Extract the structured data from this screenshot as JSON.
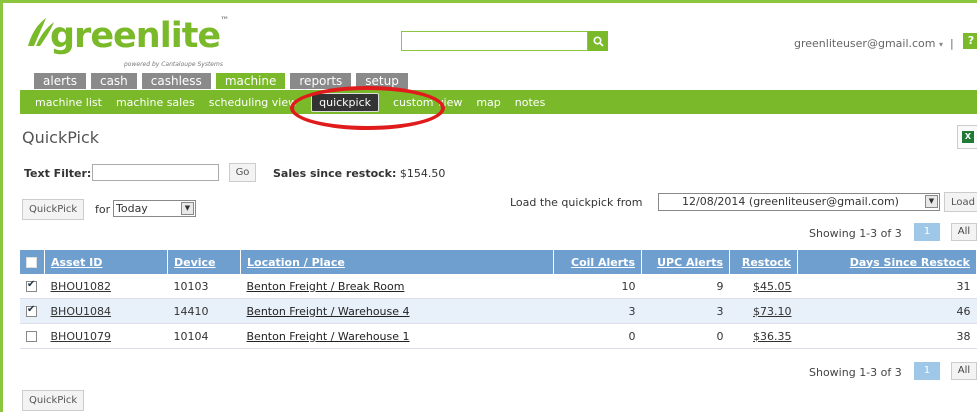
{
  "brand": {
    "logo_main": "greenlite",
    "logo_tm": "™",
    "logo_sub": "powered by Cantaloupe Systems"
  },
  "header": {
    "user_email": "greenliteuser@gmail.com",
    "user_caret": "▾",
    "separator": "|",
    "help_label": "?"
  },
  "tabs": [
    "alerts",
    "cash",
    "cashless",
    "machine",
    "reports",
    "setup"
  ],
  "active_tab": "machine",
  "subnav": [
    "machine list",
    "machine sales",
    "scheduling view",
    "quickpick",
    "custom view",
    "map",
    "notes"
  ],
  "active_subnav": "quickpick",
  "page": {
    "title": "QuickPick"
  },
  "filter": {
    "label": "Text Filter:",
    "value": "",
    "go_label": "Go",
    "sales_label": "Sales since restock:",
    "sales_value": "$154.50"
  },
  "controls": {
    "quickpick_label": "QuickPick",
    "for_label": "for",
    "for_value": "Today",
    "load_label": "Load the quickpick from",
    "load_value": "12/08/2014 (greenliteuser@gmail.com)",
    "load_button": "Load"
  },
  "pagination": {
    "showing": "Showing 1-3 of 3",
    "page": "1",
    "all_label": "All"
  },
  "table": {
    "headers": [
      "Asset ID",
      "Device",
      "Location / Place",
      "Coil Alerts",
      "UPC Alerts",
      "Restock",
      "Days Since Restock"
    ],
    "rows": [
      {
        "checked": true,
        "asset": "BHOU1082",
        "device": "10103",
        "location": "Benton Freight / Break Room",
        "coil": "10",
        "upc": "9",
        "restock": "$45.05",
        "days": "31"
      },
      {
        "checked": true,
        "asset": "BHOU1084",
        "device": "14410",
        "location": "Benton Freight / Warehouse 4",
        "coil": "3",
        "upc": "3",
        "restock": "$73.10",
        "days": "46"
      },
      {
        "checked": false,
        "asset": "BHOU1079",
        "device": "10104",
        "location": "Benton Freight / Warehouse 1",
        "coil": "0",
        "upc": "0",
        "restock": "$36.35",
        "days": "38"
      }
    ]
  },
  "colors": {
    "brand_green": "#7ab929",
    "header_blue": "#6f9fcf",
    "highlight_red": "#e01b1b"
  }
}
